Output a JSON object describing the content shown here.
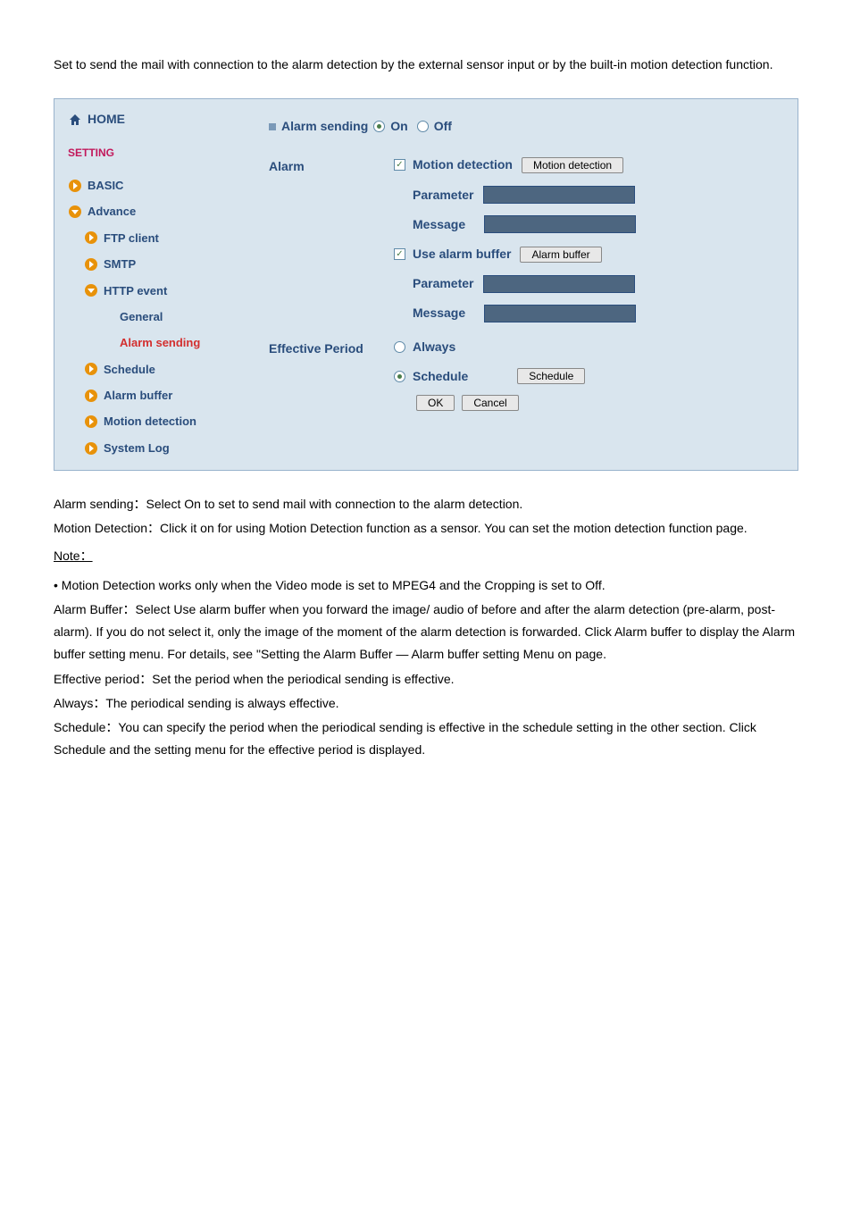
{
  "intro": "Set to send the mail with connection to the alarm detection by the external sensor input or by the built-in motion detection function.",
  "sidebar": {
    "home": "HOME",
    "setting": "SETTING",
    "items": [
      {
        "label": "BASIC",
        "indent": 0,
        "arrow": "right"
      },
      {
        "label": "Advance",
        "indent": 0,
        "arrow": "down"
      },
      {
        "label": "FTP client",
        "indent": 1,
        "arrow": "right"
      },
      {
        "label": "SMTP",
        "indent": 1,
        "arrow": "right"
      },
      {
        "label": "HTTP event",
        "indent": 1,
        "arrow": "down"
      },
      {
        "label": "General",
        "indent": 2,
        "arrow": "none"
      },
      {
        "label": "Alarm sending",
        "indent": 2,
        "arrow": "none",
        "active": true
      },
      {
        "label": "Schedule",
        "indent": 1,
        "arrow": "right"
      },
      {
        "label": "Alarm buffer",
        "indent": 1,
        "arrow": "right"
      },
      {
        "label": "Motion detection",
        "indent": 1,
        "arrow": "right"
      },
      {
        "label": "System Log",
        "indent": 1,
        "arrow": "right"
      }
    ]
  },
  "content": {
    "header_label": "Alarm sending",
    "on": "On",
    "off": "Off",
    "alarm_label": "Alarm",
    "motion_detection": "Motion detection",
    "motion_detection_btn": "Motion detection",
    "parameter": "Parameter",
    "message": "Message",
    "use_alarm_buffer": "Use alarm buffer",
    "alarm_buffer_btn": "Alarm buffer",
    "effective_period": "Effective Period",
    "always": "Always",
    "schedule": "Schedule",
    "schedule_btn": "Schedule",
    "ok": "OK",
    "cancel": "Cancel"
  },
  "descriptions": {
    "d1": "Alarm sending：Select On to set to send mail with connection to the alarm detection.",
    "d2": "Motion Detection：Click it on for using Motion Detection function as a sensor. You can set the motion detection function page.",
    "note": "Note：",
    "d3": "• Motion Detection works only when the Video mode is set to MPEG4 and the Cropping is set to Off.",
    "d4": "Alarm Buffer：Select Use alarm buffer when you forward the image/ audio of before and after the alarm detection (pre-alarm, post-alarm). If you do not select it, only the image of the moment of the alarm detection is forwarded. Click Alarm buffer to display the Alarm buffer setting menu. For details, see \"Setting the Alarm Buffer — Alarm buffer setting Menu on page.",
    "d5": "Effective period：Set the period when the periodical sending is effective.",
    "d6": "Always：The periodical sending is always effective.",
    "d7": "Schedule：You can specify the period when the periodical sending is effective in the schedule setting in the other section. Click Schedule and the setting menu for the effective period is displayed."
  }
}
